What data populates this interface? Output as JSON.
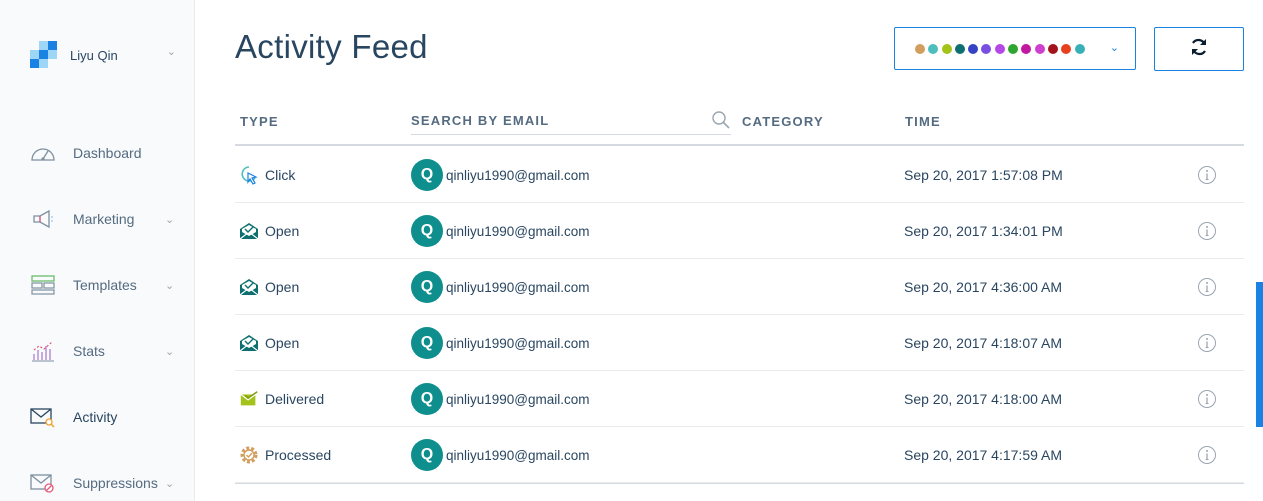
{
  "account": {
    "name": "Liyu Qin"
  },
  "sidebar": {
    "items": [
      {
        "label": "Dashboard",
        "icon": "gauge-icon",
        "has_submenu": false
      },
      {
        "label": "Marketing",
        "icon": "megaphone-icon",
        "has_submenu": true
      },
      {
        "label": "Templates",
        "icon": "templates-icon",
        "has_submenu": true
      },
      {
        "label": "Stats",
        "icon": "stats-icon",
        "has_submenu": true
      },
      {
        "label": "Activity",
        "icon": "activity-envelope-icon",
        "has_submenu": false,
        "active": true
      },
      {
        "label": "Suppressions",
        "icon": "suppressions-envelope-icon",
        "has_submenu": true
      }
    ]
  },
  "page": {
    "title": "Activity Feed"
  },
  "event_color_filter": {
    "colors": [
      "#d19e5e",
      "#4dbdbd",
      "#a3c21a",
      "#0d6f6f",
      "#3343c2",
      "#7a4fe0",
      "#b548e5",
      "#2fa52f",
      "#c0189e",
      "#cf3fcf",
      "#a3131c",
      "#e8401e",
      "#39b0b8"
    ]
  },
  "table": {
    "headers": {
      "type": "TYPE",
      "search_placeholder": "SEARCH BY EMAIL",
      "category": "CATEGORY",
      "time": "TIME"
    },
    "rows": [
      {
        "type": "Click",
        "icon": "click-cursor-icon",
        "avatar": "Q",
        "email": "qinliyu1990@gmail.com",
        "time": "Sep 20, 2017 1:57:08 PM"
      },
      {
        "type": "Open",
        "icon": "open-envelope-icon",
        "avatar": "Q",
        "email": "qinliyu1990@gmail.com",
        "time": "Sep 20, 2017 1:34:01 PM"
      },
      {
        "type": "Open",
        "icon": "open-envelope-icon",
        "avatar": "Q",
        "email": "qinliyu1990@gmail.com",
        "time": "Sep 20, 2017 4:36:00 AM"
      },
      {
        "type": "Open",
        "icon": "open-envelope-icon",
        "avatar": "Q",
        "email": "qinliyu1990@gmail.com",
        "time": "Sep 20, 2017 4:18:07 AM"
      },
      {
        "type": "Delivered",
        "icon": "delivered-envelope-icon",
        "avatar": "Q",
        "email": "qinliyu1990@gmail.com",
        "time": "Sep 20, 2017 4:18:00 AM"
      },
      {
        "type": "Processed",
        "icon": "processed-gear-icon",
        "avatar": "Q",
        "email": "qinliyu1990@gmail.com",
        "time": "Sep 20, 2017 4:17:59 AM"
      }
    ]
  }
}
